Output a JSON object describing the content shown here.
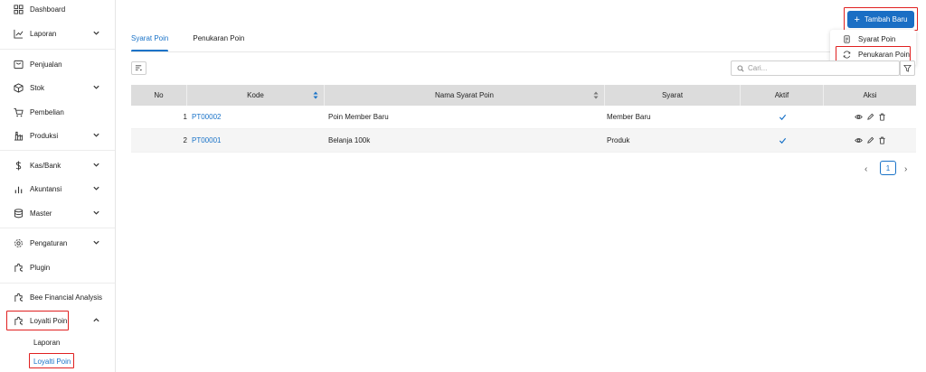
{
  "sidebar": {
    "items": [
      {
        "label": "Dashboard",
        "icon": "grid-icon"
      },
      {
        "label": "Laporan",
        "icon": "chart-line-icon"
      },
      {
        "label": "Penjualan",
        "icon": "sales-icon"
      },
      {
        "label": "Stok",
        "icon": "box-icon"
      },
      {
        "label": "Pembelian",
        "icon": "cart-icon"
      },
      {
        "label": "Produksi",
        "icon": "factory-icon"
      },
      {
        "label": "Kas/Bank",
        "icon": "dollar-icon"
      },
      {
        "label": "Akuntansi",
        "icon": "bar-chart-icon"
      },
      {
        "label": "Master",
        "icon": "database-icon"
      },
      {
        "label": "Pengaturan",
        "icon": "gear-icon"
      },
      {
        "label": "Plugin",
        "icon": "plugin-icon"
      },
      {
        "label": "Bee Financial Analysis",
        "icon": "plugin-icon"
      },
      {
        "label": "Loyalti Poin",
        "icon": "plugin-icon"
      }
    ],
    "sub_items": [
      {
        "label": "Laporan"
      },
      {
        "label": "Loyalti Poin"
      }
    ]
  },
  "tabs": [
    {
      "label": "Syarat Poin"
    },
    {
      "label": "Penukaran Poin"
    }
  ],
  "actions": {
    "add_label": "Tambah Baru",
    "dropdown": [
      {
        "label": "Syarat Poin",
        "icon": "document-icon"
      },
      {
        "label": "Penukaran Poin",
        "icon": "exchange-icon"
      }
    ]
  },
  "search": {
    "placeholder": "Cari..."
  },
  "table": {
    "headers": {
      "no": "No",
      "kode": "Kode",
      "nama": "Nama Syarat Poin",
      "syarat": "Syarat",
      "aktif": "Aktif",
      "aksi": "Aksi"
    },
    "rows": [
      {
        "no": "1",
        "kode": "PT00002",
        "nama": "Poin Member Baru",
        "syarat": "Member Baru",
        "aktif": true
      },
      {
        "no": "2",
        "kode": "PT00001",
        "nama": "Belanja 100k",
        "syarat": "Produk",
        "aktif": true
      }
    ]
  },
  "pagination": {
    "current": "1"
  },
  "colors": {
    "accent": "#1a73c8",
    "highlight": "#e02020",
    "header_bg": "#dcdcdc"
  }
}
